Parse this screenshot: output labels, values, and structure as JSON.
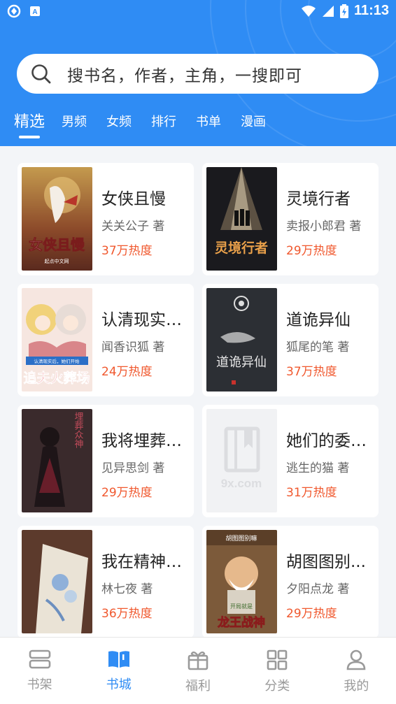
{
  "status_bar": {
    "time": "11:13"
  },
  "search": {
    "placeholder": "搜书名，作者，主角，一搜即可"
  },
  "tabs": [
    {
      "label": "精选",
      "active": true
    },
    {
      "label": "男频"
    },
    {
      "label": "女频"
    },
    {
      "label": "排行"
    },
    {
      "label": "书单"
    },
    {
      "label": "漫画"
    }
  ],
  "books": [
    {
      "title": "女侠且慢",
      "author": "关关公子 著",
      "heat": "37万热度",
      "cover_text": "女侠且慢",
      "cover_sub": "起点中文网"
    },
    {
      "title": "灵境行者",
      "author": "卖报小郎君 著",
      "heat": "29万热度",
      "cover_text": "灵境行者"
    },
    {
      "title": "认清现实后...",
      "author": "闻香识狐 著",
      "heat": "24万热度",
      "cover_text": "追夫火葬场",
      "cover_sub": "认清现实后，她们开始"
    },
    {
      "title": "道诡异仙",
      "author": "狐尾的笔 著",
      "heat": "37万热度",
      "cover_text": "道诡异仙"
    },
    {
      "title": "我将埋葬众神",
      "author": "见异思剑 著",
      "heat": "29万热度",
      "cover_text": "埋葬众神"
    },
    {
      "title": "她们的委托...",
      "author": "逃生的猫 著",
      "heat": "31万热度",
      "cover_text": "9x.com"
    },
    {
      "title": "我在精神病院",
      "author": "林七夜 著",
      "heat": "36万热度"
    },
    {
      "title": "胡图图别...",
      "author": "夕阳点龙 著",
      "heat": "29万热度",
      "cover_text": "龙王战神",
      "cover_sub": "胡图图别嘛",
      "cover_sub2": "开局就是"
    }
  ],
  "bottom_nav": [
    {
      "label": "书架",
      "icon": "bookshelf-icon"
    },
    {
      "label": "书城",
      "icon": "book-open-icon",
      "active": true
    },
    {
      "label": "福利",
      "icon": "gift-icon"
    },
    {
      "label": "分类",
      "icon": "grid-icon"
    },
    {
      "label": "我的",
      "icon": "user-icon"
    }
  ],
  "colors": {
    "primary": "#2f8cf4",
    "heat": "#f0582e"
  }
}
